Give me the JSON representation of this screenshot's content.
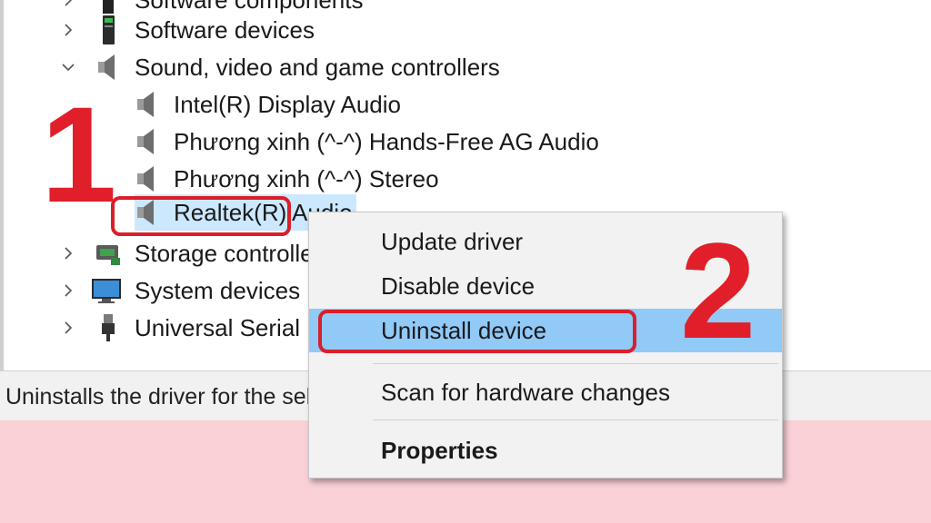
{
  "tree": {
    "top_partial": "Software components",
    "software_devices": "Software devices",
    "sound_category": "Sound, video and game controllers",
    "children": [
      "Intel(R) Display Audio",
      "Phương xinh (^-^) Hands-Free AG Audio",
      "Phương xinh (^-^) Stereo",
      "Realtek(R) Audio"
    ],
    "storage": "Storage controllers",
    "system": "System devices",
    "usb": "Universal Serial Bus controllers"
  },
  "status_bar": {
    "text": "Uninstalls the driver for the selected device."
  },
  "context_menu": {
    "update": "Update driver",
    "disable": "Disable device",
    "uninstall": "Uninstall device",
    "scan": "Scan for hardware changes",
    "properties": "Properties"
  },
  "annotations": {
    "step1": "1",
    "step2": "2"
  },
  "colors": {
    "accent_red": "#e01f2a",
    "highlight": "#91c9f7",
    "selection": "#cce8ff",
    "page_background": "#f9d1d6"
  },
  "icons": [
    "chevron-right-icon",
    "chevron-down-icon",
    "speaker-icon",
    "chip-icon",
    "storage-icon",
    "monitor-icon",
    "usb-icon"
  ]
}
